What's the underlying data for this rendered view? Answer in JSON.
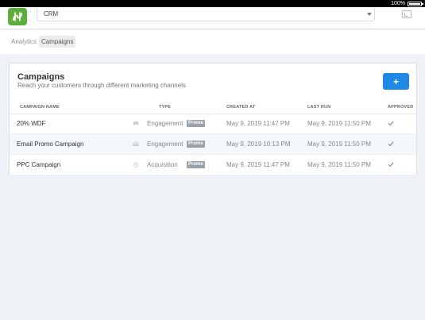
{
  "status": {
    "battery_text": "100%"
  },
  "header": {
    "app_selected": "CRM"
  },
  "nav": {
    "tabs": [
      {
        "label": "Analytics"
      },
      {
        "label": "Campaigns"
      }
    ]
  },
  "card": {
    "title": "Campaigns",
    "subtitle": "Reach your customers through different marketing channels",
    "add_label": "+"
  },
  "table": {
    "headers": [
      "CAMPAIGN NAME",
      "TYPE",
      "CREATED AT",
      "LAST RUN",
      "APPROVED"
    ],
    "rows": [
      {
        "name": "20% WDF",
        "channel_icon": "chat-icon",
        "type": "Engagement",
        "badge": "Promo",
        "created": "May 9, 2019 11:47 PM",
        "last_run": "May 9, 2019 11:50 PM",
        "approved": true
      },
      {
        "name": "Email Promo Campaign",
        "channel_icon": "mail-icon",
        "type": "Engagement",
        "badge": "Promo",
        "created": "May 9, 2019 10:13 PM",
        "last_run": "May 9, 2019 11:50 PM",
        "approved": true
      },
      {
        "name": "PPC Campaign",
        "channel_icon": "target-icon",
        "type": "Acquisition",
        "badge": "Promo",
        "created": "May 9, 2019 11:47 PM",
        "last_run": "May 9, 2019 11:50 PM",
        "approved": true
      }
    ]
  },
  "colors": {
    "brand": "#5fae3b",
    "accent": "#1e88e5"
  }
}
